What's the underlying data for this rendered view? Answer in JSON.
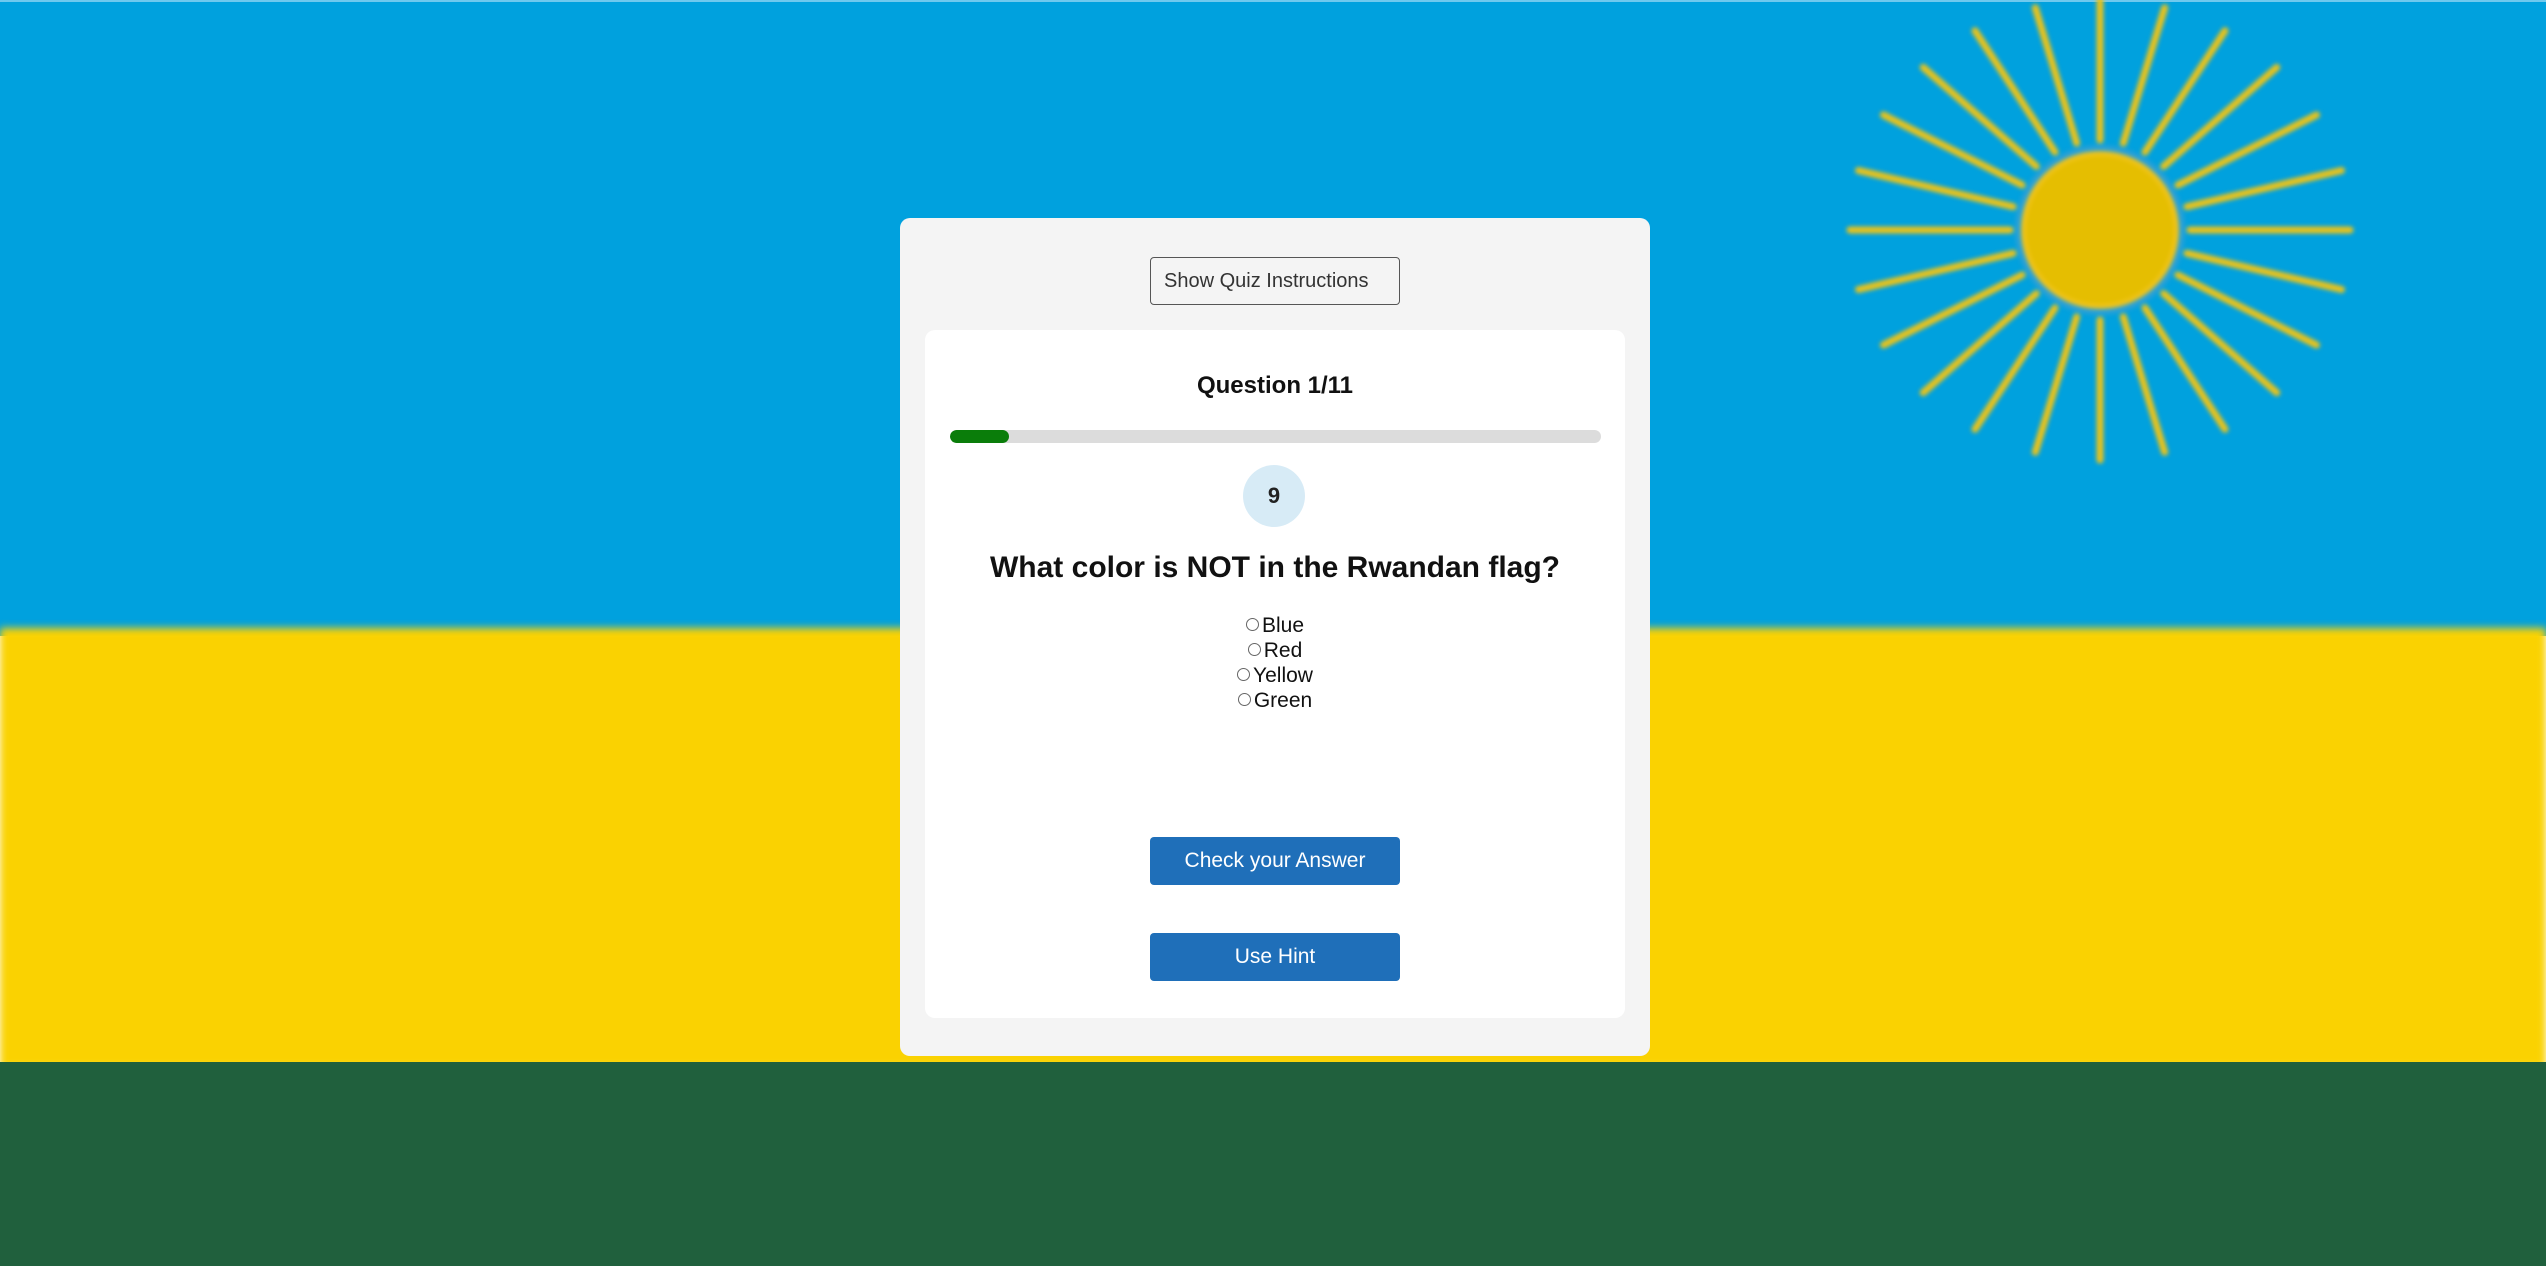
{
  "background": {
    "colors": {
      "blue": "#00a1de",
      "yellow": "#fad201",
      "green": "#20603d",
      "sun": "#e5be01"
    },
    "sun_icon": "sun-icon"
  },
  "quiz": {
    "instructions_button": "Show Quiz Instructions",
    "question_counter": "Question 1/11",
    "progress_fraction": 0.09,
    "timer_value": "9",
    "question_text": "What color is NOT in the Rwandan flag?",
    "options": [
      {
        "label": "Blue"
      },
      {
        "label": "Red"
      },
      {
        "label": "Yellow"
      },
      {
        "label": "Green"
      }
    ],
    "check_button": "Check your Answer",
    "hint_button": "Use Hint",
    "accent_color": "#1f6fb9",
    "progress_color": "#0a7d0a"
  }
}
